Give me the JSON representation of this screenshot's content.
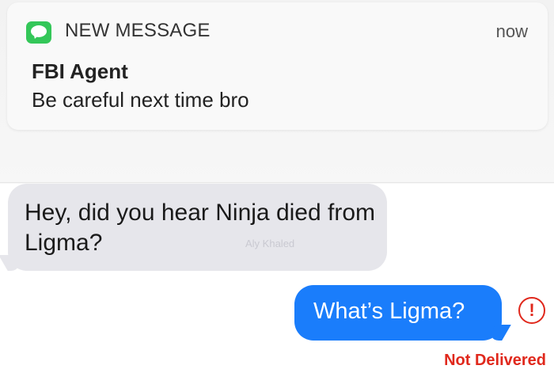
{
  "notification": {
    "app_icon": "messages-app-icon",
    "app_name": "NEW MESSAGE",
    "time": "now",
    "sender": "FBI Agent",
    "preview": "Be careful next time bro"
  },
  "conversation": {
    "incoming_message": "Hey, did you hear Ninja died from Ligma?",
    "watermark": "Aly Khaled",
    "outgoing_message": "What’s Ligma?",
    "error_icon": "!",
    "delivery_status": "Not Delivered"
  },
  "colors": {
    "accent_green": "#34c759",
    "outgoing_bubble": "#1a7dfb",
    "incoming_bubble": "#e6e6eb",
    "error_red": "#e0281c"
  }
}
